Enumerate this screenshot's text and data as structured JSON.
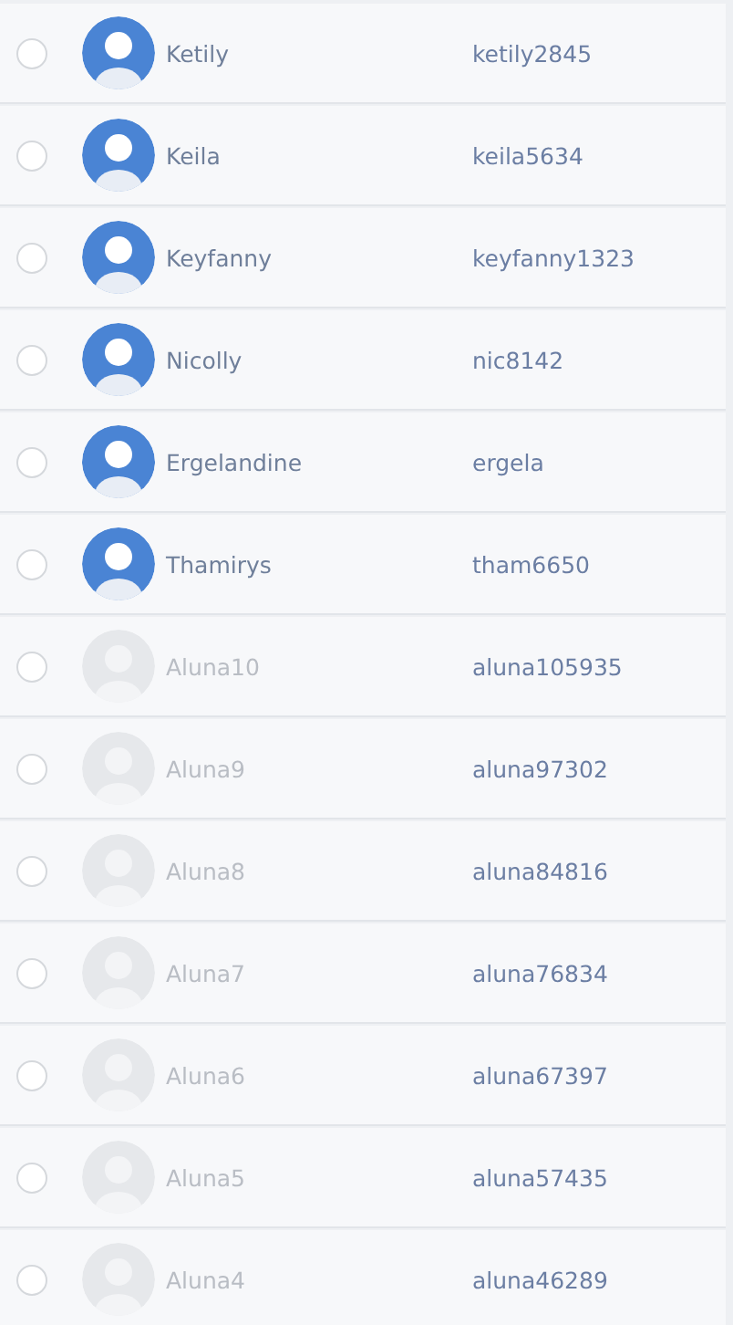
{
  "users": [
    {
      "name": "Ketily",
      "username": "ketily2845",
      "active": true,
      "selected": false
    },
    {
      "name": "Keila",
      "username": "keila5634",
      "active": true,
      "selected": false
    },
    {
      "name": "Keyfanny",
      "username": "keyfanny1323",
      "active": true,
      "selected": false
    },
    {
      "name": "Nicolly",
      "username": "nic8142",
      "active": true,
      "selected": false
    },
    {
      "name": "Ergelandine",
      "username": "ergela",
      "active": true,
      "selected": false
    },
    {
      "name": "Thamirys",
      "username": "tham6650",
      "active": true,
      "selected": false
    },
    {
      "name": "Aluna10",
      "username": "aluna105935",
      "active": false,
      "selected": false
    },
    {
      "name": "Aluna9",
      "username": "aluna97302",
      "active": false,
      "selected": false
    },
    {
      "name": "Aluna8",
      "username": "aluna84816",
      "active": false,
      "selected": false
    },
    {
      "name": "Aluna7",
      "username": "aluna76834",
      "active": false,
      "selected": false
    },
    {
      "name": "Aluna6",
      "username": "aluna67397",
      "active": false,
      "selected": false
    },
    {
      "name": "Aluna5",
      "username": "aluna57435",
      "active": false,
      "selected": false
    },
    {
      "name": "Aluna4",
      "username": "aluna46289",
      "active": false,
      "selected": false
    }
  ]
}
